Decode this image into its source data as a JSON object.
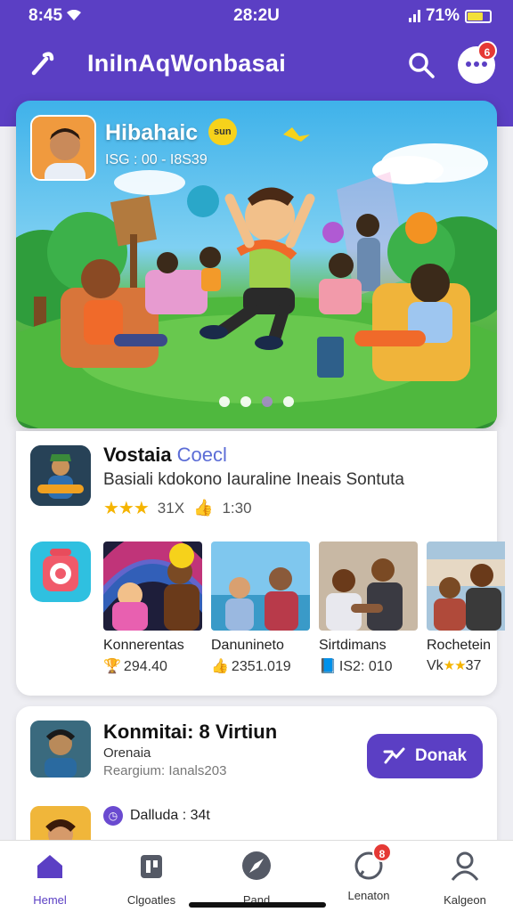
{
  "status": {
    "left": "8:45",
    "time": "28:2U",
    "battery": "71%"
  },
  "appbar": {
    "title": "IniInAqWonbasai",
    "chat_badge": "6"
  },
  "hero": {
    "title": "Hibahaic",
    "chip": "sun",
    "subtitle": "ISG : 00 - I8S39",
    "pages": 4,
    "active_page": 0
  },
  "feature": {
    "title": "Vostaia",
    "tag": "Coecl",
    "description": "Basiali kdokono Iauraline Ineais Sontuta",
    "rating_text": "31X",
    "likes": "1:30"
  },
  "tiles": [
    {
      "name": "Konnerentas",
      "stat": "294.40"
    },
    {
      "name": "Danunineto",
      "stat": "2351.019"
    },
    {
      "name": "Sirtdimans",
      "stat": "IS2: 010"
    },
    {
      "name": "Rochetein",
      "stat": "37"
    }
  ],
  "tile4_prefix": "Vk",
  "event": {
    "title": "Konmitai: 8 Virtiun",
    "line1": "Orenaia",
    "line2": "Reargium: Ianals203",
    "button": "Donak"
  },
  "next_item": {
    "label": "Dalluda : 34t"
  },
  "tabs": [
    {
      "label": "Hemel"
    },
    {
      "label": "Clgoatles"
    },
    {
      "label": "Pand"
    },
    {
      "label": "Lenaton",
      "badge": "8"
    },
    {
      "label": "Kalgeon"
    }
  ]
}
